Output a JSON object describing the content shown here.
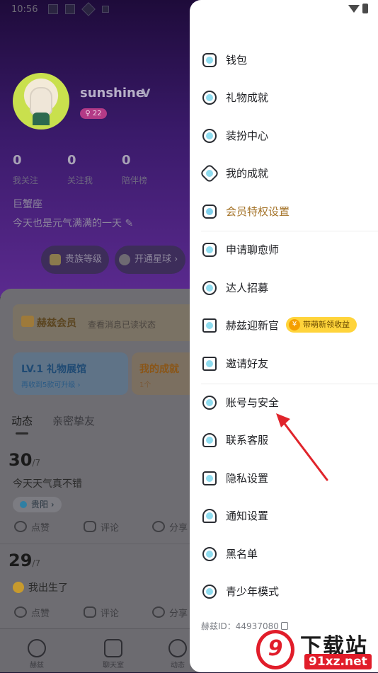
{
  "status_bar": {
    "time": "10:56"
  },
  "profile": {
    "username": "sunshine",
    "level": "22",
    "stats": [
      {
        "value": "0",
        "label": "我关注"
      },
      {
        "value": "0",
        "label": "关注我"
      },
      {
        "value": "0",
        "label": "陪伴榜"
      }
    ],
    "zodiac": "巨蟹座",
    "motto": "今天也是元气满满的一天",
    "buttons": [
      "贵族等级",
      "开通星球"
    ]
  },
  "member_card": {
    "title": "赫兹会员",
    "subtitle": "查看消息已读状态"
  },
  "gift_card": {
    "title": "LV.1 礼物展馆",
    "subtitle": "再收到5款可升级"
  },
  "achievement_card": {
    "title": "我的成就",
    "subtitle": "1个"
  },
  "tabs": [
    "动态",
    "亲密挚友"
  ],
  "posts": [
    {
      "day": "30",
      "month": "/7",
      "text": "今天天气真不错",
      "location": "贵阳"
    },
    {
      "day": "29",
      "month": "/7",
      "text": "我出生了"
    }
  ],
  "post_actions": [
    "点赞",
    "评论",
    "分享"
  ],
  "bottom_nav": [
    "赫兹",
    "聊天室",
    "动态"
  ],
  "drawer": {
    "items": [
      {
        "label": "钱包",
        "icon": "wallet-icon"
      },
      {
        "label": "礼物成就",
        "icon": "gift-achievement-icon"
      },
      {
        "label": "装扮中心",
        "icon": "dressup-icon"
      },
      {
        "label": "我的成就",
        "icon": "star-icon"
      },
      {
        "label": "会员特权设置",
        "icon": "crown-icon"
      },
      {
        "label": "申请聊愈师",
        "icon": "heart-chat-icon"
      },
      {
        "label": "达人招募",
        "icon": "badge-icon"
      },
      {
        "label": "赫兹迎新官",
        "icon": "id-card-icon"
      },
      {
        "label": "邀请好友",
        "icon": "invite-icon"
      },
      {
        "label": "账号与安全",
        "icon": "account-security-icon"
      },
      {
        "label": "联系客服",
        "icon": "headset-icon"
      },
      {
        "label": "隐私设置",
        "icon": "lock-icon"
      },
      {
        "label": "通知设置",
        "icon": "bell-icon"
      },
      {
        "label": "黑名单",
        "icon": "blacklist-icon"
      },
      {
        "label": "青少年模式",
        "icon": "youth-mode-icon"
      }
    ],
    "promo_badge": "带萌新领收益",
    "promo_coin": "¥",
    "user_id_label": "赫兹ID：",
    "user_id": "44937080"
  },
  "watermark": {
    "logo": "9",
    "text": "下载站",
    "url": "91xz.net"
  },
  "colors": {
    "accent_gold": "#a5742a",
    "badge_yellow": "#ffd43b",
    "arrow_red": "#e0242b"
  }
}
